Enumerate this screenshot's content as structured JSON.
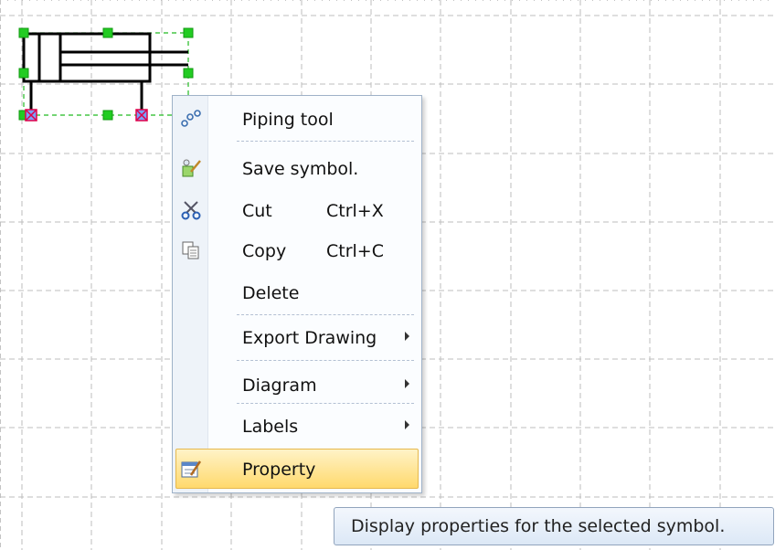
{
  "menu": {
    "items": [
      {
        "label": "Piping tool",
        "shortcut": "",
        "icon": "piping-tool-icon"
      },
      {
        "label": "Save symbol.",
        "shortcut": "",
        "icon": "save-symbol-icon"
      },
      {
        "label": "Cut",
        "shortcut": "Ctrl+X",
        "icon": "scissors-icon"
      },
      {
        "label": "Copy",
        "shortcut": "Ctrl+C",
        "icon": "copy-icon"
      },
      {
        "label": "Delete",
        "shortcut": "",
        "icon": ""
      },
      {
        "label": "Export Drawing",
        "shortcut": "",
        "icon": "",
        "submenu": true
      },
      {
        "label": "Diagram",
        "shortcut": "",
        "icon": "",
        "submenu": true
      },
      {
        "label": "Labels",
        "shortcut": "",
        "icon": "",
        "submenu": true
      },
      {
        "label": "Property",
        "shortcut": "",
        "icon": "property-icon",
        "highlighted": true
      }
    ]
  },
  "tooltip": {
    "text": "Display properties for the selected symbol."
  },
  "colors": {
    "highlight": "#ffd96d",
    "selection_handle": "#22cc22",
    "grid": "#c4c4c4"
  }
}
